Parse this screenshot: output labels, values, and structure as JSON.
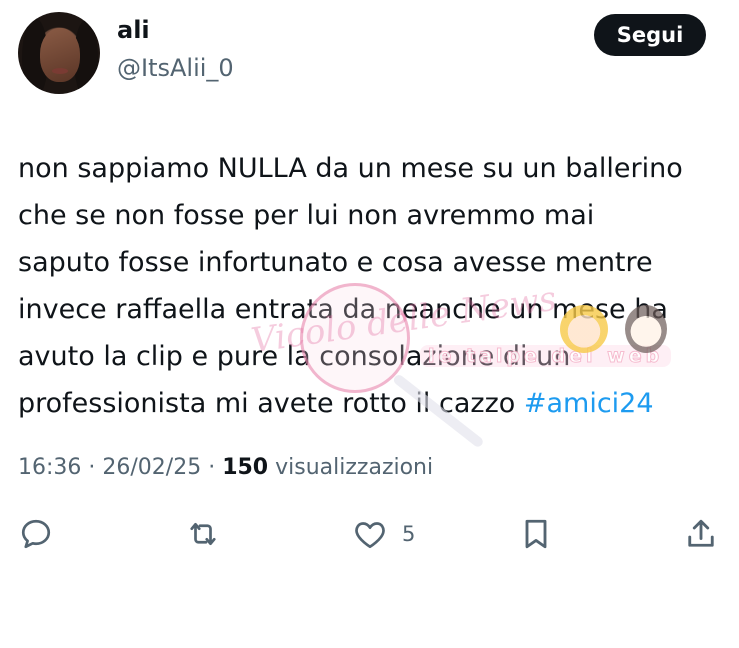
{
  "user": {
    "name": "ali",
    "handle": "@ItsAlii_0"
  },
  "follow_button": {
    "label": "Segui"
  },
  "tweet": {
    "text": "non sappiamo NULLA da un mese su un ballerino\nche se non fosse per lui non avremmo mai\nsaputo fosse infortunato e cosa avesse mentre\ninvece raffaella entrata da neanche un mese ha\navuto la clip e pure la consolazione di un\nprofessionista mi avete rotto il cazzo ",
    "hashtag": "#amici24"
  },
  "meta": {
    "time": "16:36",
    "sep1": " · ",
    "date": "26/02/25",
    "sep2": " · ",
    "views_count": "150",
    "views_label": " visualizzazioni"
  },
  "watermark": {
    "script_text": "Vicolo delle News",
    "banner_text": "le talpe del web"
  },
  "actions": {
    "reply": {
      "icon": "reply-icon"
    },
    "repost": {
      "icon": "repost-icon"
    },
    "like": {
      "icon": "heart-icon",
      "count": "5"
    },
    "bookmark": {
      "icon": "bookmark-icon"
    },
    "share": {
      "icon": "share-icon"
    }
  },
  "colors": {
    "text": "#0f1419",
    "secondary": "#536471",
    "link": "#1d9bf0",
    "button_bg": "#0f1419"
  }
}
